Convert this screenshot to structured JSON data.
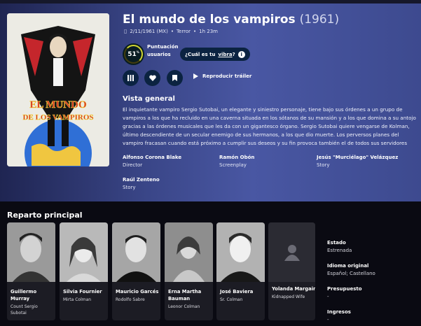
{
  "movie": {
    "title": "El mundo de los vampiros",
    "year": "(1961)",
    "release": "2/11/1961 (MX)",
    "genre": "Terror",
    "runtime": "1h 23m",
    "score": "51",
    "score_sup": "%",
    "score_label_1": "Puntuación",
    "score_label_2": "de",
    "score_label_3": "usuarios",
    "vibe_prefix": "¿Cuál es tu",
    "vibe_link": "vibra",
    "vibe_suffix": "?",
    "trailer_label": "Reproducir tráiler",
    "overview_heading": "Vista general",
    "overview": "El inquietante vampiro Sergio Sutobai, un elegante y siniestro personaje, tiene bajo sus órdenes a un grupo de vampiros a los que ha recluido en una caverna situada en los sótanos de su mansión y a los que domina a su antojo gracias a las órdenes musicales que les da con un gigantesco órgano. Sergio Sutobai quiere vengarse de Kolman, último descendiente de un secular enemigo de sus hermanos, a los que dio muerte. Los perversos planes del vampiro fracasan cuando está próximo a cumplir sus deseos y su fin provoca también el de todos sus servidores",
    "poster_text_1": "EL MUNDO",
    "poster_text_2": "DE LOS VAMPIROS"
  },
  "crew": [
    {
      "name": "Alfonso Corona Blake",
      "role": "Director"
    },
    {
      "name": "Ramón Obón",
      "role": "Screenplay"
    },
    {
      "name": "Jesús \"Murciélago\" Velázquez",
      "role": "Story"
    },
    {
      "name": "Raúl Zenteno",
      "role": "Story"
    }
  ],
  "cast_heading": "Reparto principal",
  "cast": [
    {
      "name_1": "Guillermo",
      "name_2": "Murray",
      "char_1": "Count Sergio",
      "char_2": "Subotai"
    },
    {
      "name_1": "Silvia Fournier",
      "name_2": "",
      "char_1": "Mirta Colman",
      "char_2": ""
    },
    {
      "name_1": "Mauricio Garcés",
      "name_2": "",
      "char_1": "Rodolfo Sabre",
      "char_2": ""
    },
    {
      "name_1": "Erna Martha",
      "name_2": "Bauman",
      "char_1": "Leonor Colman",
      "char_2": ""
    },
    {
      "name_1": "José Baviera",
      "name_2": "",
      "char_1": "Sr. Colman",
      "char_2": ""
    },
    {
      "name_1": "Yolanda Margain",
      "name_2": "",
      "char_1": "Kidnapped Wife",
      "char_2": ""
    }
  ],
  "facts": [
    {
      "label": "Estado",
      "value": "Estrenada"
    },
    {
      "label": "Idioma original",
      "value": "Español; Castellano"
    },
    {
      "label": "Presupuesto",
      "value": "-"
    },
    {
      "label": "Ingresos",
      "value": "-"
    }
  ],
  "colors": {
    "accent": "#d2d531",
    "hero": "#4957a3",
    "button": "#0b2341"
  }
}
